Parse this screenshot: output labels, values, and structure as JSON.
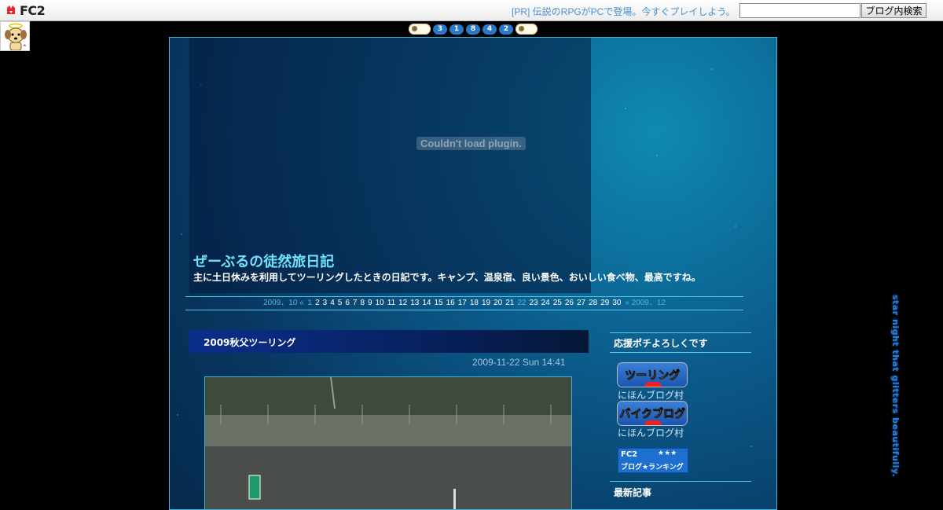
{
  "topbar": {
    "logo_text": "FC2",
    "pr_link": "[PR] 伝説のRPGがPCで登場。今すぐプレイしよう。",
    "search_value": "",
    "search_button": "ブログ内検索"
  },
  "counter": {
    "digits": [
      "3",
      "1",
      "8",
      "4",
      "2"
    ]
  },
  "header": {
    "plugin_message": "Couldn't load plugin.",
    "title": "ぜーぶるの徒然旅日記",
    "description": "主に土日休みを利用してツーリングしたときの日記です。キャンプ、温泉宿、良い景色、おいしい食べ物、最高ですね。"
  },
  "calendar": {
    "prev": "2009．10 «",
    "next": "» 2009．12",
    "days": [
      "1",
      "2",
      "3",
      "4",
      "5",
      "6",
      "7",
      "8",
      "9",
      "10",
      "11",
      "12",
      "13",
      "14",
      "15",
      "16",
      "17",
      "18",
      "19",
      "20",
      "21",
      "22",
      "23",
      "24",
      "25",
      "26",
      "27",
      "28",
      "29",
      "30"
    ],
    "highlighted": [
      "1",
      "22"
    ]
  },
  "entry": {
    "title": "2009秋父ツーリング",
    "date": "2009-11-22 Sun 14:41"
  },
  "sidebar": {
    "section1_title": "応援ポチよろしくです",
    "badges": [
      {
        "label": "ツーリング",
        "caption": "にほんブログ村"
      },
      {
        "label": "バイクブログ",
        "caption": "にほんブログ村"
      }
    ],
    "fc2_rank": {
      "line1": "FC2",
      "stars": "★★★",
      "line2": "ブログ★ランキング"
    },
    "section2_title": "最新記事"
  },
  "vertical_text": "star night that glitters beautifully.",
  "colors": {
    "accent": "#6fe3ff",
    "border": "#58c9e8",
    "link": "#4fb6de"
  }
}
